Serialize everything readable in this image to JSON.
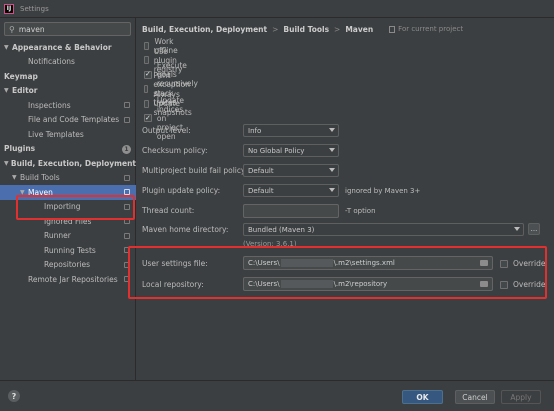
{
  "window": {
    "title": "Settings",
    "app_icon_text": "IJ"
  },
  "search": {
    "value": "maven",
    "icon": "search-icon"
  },
  "sidebar": {
    "items": [
      {
        "label": "Appearance & Behavior",
        "level": 0,
        "bold": true,
        "expanded": true
      },
      {
        "label": "Notifications",
        "level": 2
      },
      {
        "label": "Keymap",
        "level": 0,
        "bold": true
      },
      {
        "label": "Editor",
        "level": 0,
        "bold": true,
        "expanded": true
      },
      {
        "label": "Inspections",
        "level": 2,
        "copy": true
      },
      {
        "label": "File and Code Templates",
        "level": 2,
        "copy": true
      },
      {
        "label": "Live Templates",
        "level": 2
      },
      {
        "label": "Plugins",
        "level": 0,
        "bold": true,
        "badge": "1"
      },
      {
        "label": "Build, Execution, Deployment",
        "level": 0,
        "bold": true,
        "expanded": true
      },
      {
        "label": "Build Tools",
        "level": 1,
        "expanded": true,
        "copy": true
      },
      {
        "label": "Maven",
        "level": 2,
        "expanded": true,
        "copy": true,
        "selected": true
      },
      {
        "label": "Importing",
        "level": 3,
        "copy": true
      },
      {
        "label": "Ignored Files",
        "level": 3,
        "copy": true
      },
      {
        "label": "Runner",
        "level": 3,
        "copy": true
      },
      {
        "label": "Running Tests",
        "level": 3,
        "copy": true
      },
      {
        "label": "Repositories",
        "level": 3,
        "copy": true
      },
      {
        "label": "Remote Jar Repositories",
        "level": 2,
        "copy": true
      }
    ]
  },
  "breadcrumb": {
    "parts": [
      "Build, Execution, Deployment",
      "Build Tools",
      "Maven"
    ],
    "separator": ">",
    "scope": "For current project"
  },
  "checkboxes": [
    {
      "label": "Work offline",
      "checked": false
    },
    {
      "label": "Use plugin registry",
      "checked": false
    },
    {
      "label": "Execute goals recursively",
      "checked": true
    },
    {
      "label": "Print exception stack traces",
      "checked": false
    },
    {
      "label": "Always update snapshots",
      "checked": false
    },
    {
      "label": "Update indices on project open",
      "checked": true
    }
  ],
  "check_mark": "✓",
  "fields": {
    "output_level": {
      "label": "Output level:",
      "value": "Info"
    },
    "checksum_policy": {
      "label": "Checksum policy:",
      "value": "No Global Policy"
    },
    "fail_policy": {
      "label": "Multiproject build fail policy:",
      "value": "Default"
    },
    "plugin_update": {
      "label": "Plugin update policy:",
      "value": "Default",
      "hint": "ignored by Maven 3+"
    },
    "thread_count": {
      "label": "Thread count:",
      "value": "",
      "hint": "-T option"
    },
    "maven_home": {
      "label": "Maven home directory:",
      "value": "Bundled (Maven 3)",
      "version": "(Version: 3.6.1)",
      "browse": "..."
    },
    "user_settings": {
      "label": "User settings file:",
      "prefix": "C:\\Users\\",
      "suffix": "\\.m2\\settings.xml",
      "override": "Override"
    },
    "local_repo": {
      "label": "Local repository:",
      "prefix": "C:\\Users\\",
      "suffix": "\\.m2\\repository",
      "override": "Override"
    }
  },
  "buttons": {
    "help": "?",
    "ok": "OK",
    "cancel": "Cancel",
    "apply": "Apply"
  },
  "colors": {
    "selection": "#4b6eaf",
    "highlight": "#e03030",
    "ok_button": "#365880"
  }
}
